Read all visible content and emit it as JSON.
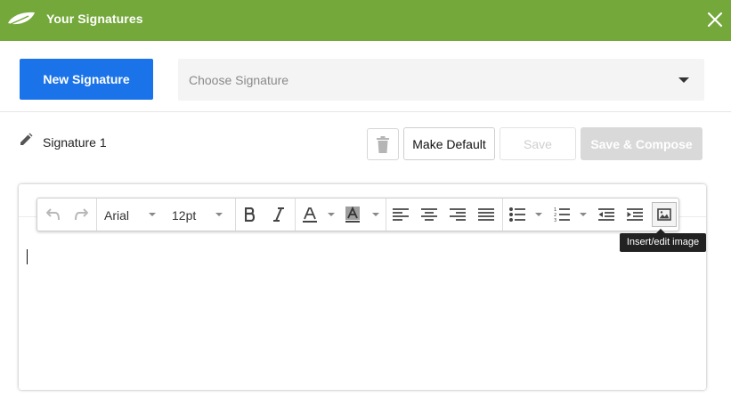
{
  "header": {
    "title": "Your Signatures",
    "logo_icon": "leaf-logo-icon",
    "close_icon": "close-icon",
    "bg_color": "#74a83a"
  },
  "controls": {
    "new_signature_label": "New Signature",
    "choose_placeholder": "Choose Signature",
    "accent_color": "#1a73e8"
  },
  "signature": {
    "name": "Signature 1",
    "edit_icon": "pencil-icon",
    "delete_icon": "trash-icon",
    "make_default_label": "Make Default",
    "save_label": "Save",
    "save_compose_label": "Save & Compose"
  },
  "toolbar": {
    "font_family": "Arial",
    "font_size": "12pt",
    "image_tooltip": "Insert/edit image",
    "icons": [
      "undo-icon",
      "redo-icon",
      "bold-icon",
      "italic-icon",
      "text-color-icon",
      "background-color-icon",
      "align-left-icon",
      "align-center-icon",
      "align-right-icon",
      "align-justify-icon",
      "bullet-list-icon",
      "numbered-list-icon",
      "outdent-icon",
      "indent-icon",
      "image-icon"
    ]
  }
}
